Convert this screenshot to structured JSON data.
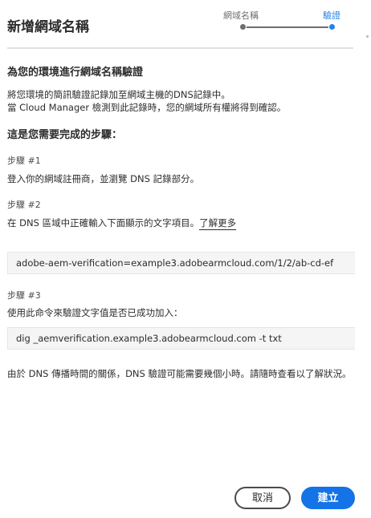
{
  "dialog": {
    "title": "新增網域名稱"
  },
  "stepper": {
    "steps": [
      {
        "label": "網域名稱",
        "state": "completed"
      },
      {
        "label": "驗證",
        "state": "current"
      }
    ],
    "colors": {
      "completed": "#6e6e6e",
      "current": "#2680eb"
    }
  },
  "intro": {
    "heading": "為您的環境進行網域名稱驗證",
    "line1": "將您環境的簡訊驗證記錄加至網域主機的DNS記錄中。",
    "line2": "當 Cloud Manager 檢測到此記錄時，您的網域所有權將得到確認。"
  },
  "steps_section": {
    "heading": "這是您需要完成的步驟：",
    "step1": {
      "title": "步驟 #1",
      "text": "登入你的網域註冊商，並瀏覽 DNS 記錄部分。"
    },
    "step2": {
      "title": "步驟 #2",
      "text": "在 DNS 區域中正確輸入下面顯示的文字項目。",
      "link": "了解更多",
      "value": "adobe-aem-verification=example3.adobearmcloud.com/1/2/ab-cd-ef"
    },
    "step3": {
      "title": "步驟 #3",
      "text": "使用此命令來驗證文字值是否已成功加入：",
      "command": "dig _aemverification.example3.adobearmcloud.com -t txt"
    }
  },
  "footer_note": "由於 DNS 傳播時間的關係，DNS 驗證可能需要幾個小時。請隨時查看以了解狀況。",
  "buttons": {
    "cancel": "取消",
    "create": "建立"
  },
  "colors": {
    "accent": "#1473e6",
    "text": "#2c2c2c",
    "code_background": "#f5f5f5"
  }
}
